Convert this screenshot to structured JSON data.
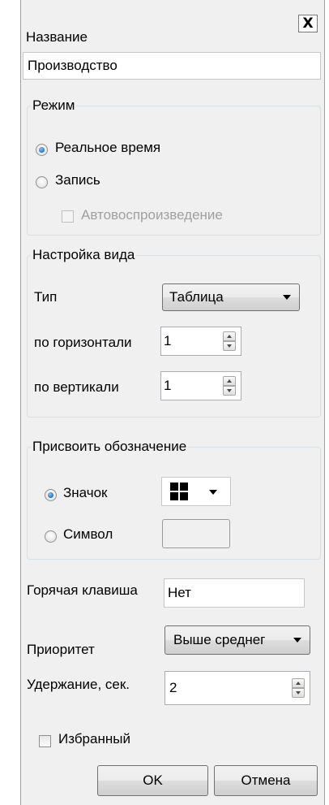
{
  "dialog": {
    "close_glyph": "X"
  },
  "name": {
    "label": "Название",
    "value": "Производство"
  },
  "mode": {
    "legend": "Режим",
    "options": [
      "Реальное время",
      "Запись"
    ],
    "selected": "Реальное время",
    "autoplay_label": "Автовоспроизведение"
  },
  "view": {
    "legend": "Настройка вида",
    "type_label": "Тип",
    "type_value": "Таблица",
    "horizontal_label": "по горизонтали",
    "horizontal_value": "1",
    "vertical_label": "по вертикали",
    "vertical_value": "1"
  },
  "designation": {
    "legend": "Присвоить обозначение",
    "icon_option": "Значок",
    "symbol_option": "Символ",
    "selected": "Значок",
    "icon_name": "grid-icon"
  },
  "hotkey": {
    "label": "Горячая клавиша",
    "value": "Нет"
  },
  "priority": {
    "label": "Приоритет",
    "value": "Выше среднег"
  },
  "hold": {
    "label": "Удержание, сек.",
    "value": "2"
  },
  "favorite": {
    "label": "Избранный",
    "checked": false
  },
  "buttons": {
    "ok": "OK",
    "cancel": "Отмена"
  }
}
